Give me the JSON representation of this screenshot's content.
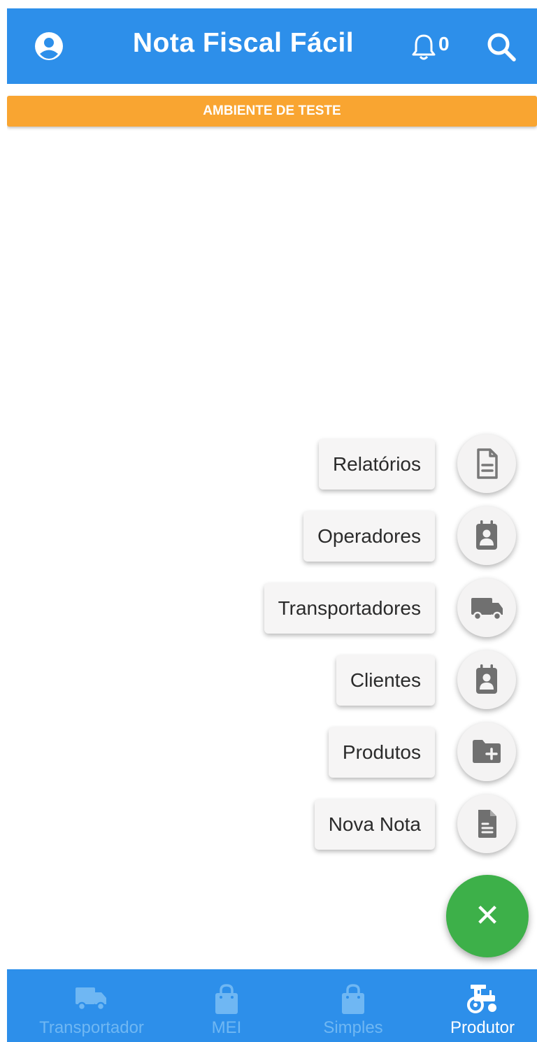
{
  "app": {
    "title": "Nota Fiscal Fácil",
    "notification_count": "0",
    "accent_color": "#2d8fea"
  },
  "banner": {
    "text": "AMBIENTE DE TESTE",
    "color": "#f9a531"
  },
  "menu": {
    "items": [
      {
        "label": "Relatórios",
        "icon": "document-outline-icon"
      },
      {
        "label": "Operadores",
        "icon": "contact-card-icon"
      },
      {
        "label": "Transportadores",
        "icon": "truck-icon"
      },
      {
        "label": "Clientes",
        "icon": "contact-card-icon"
      },
      {
        "label": "Produtos",
        "icon": "folder-add-icon"
      },
      {
        "label": "Nova Nota",
        "icon": "document-filled-icon"
      }
    ]
  },
  "fab": {
    "symbol": "✕",
    "color": "#3db049"
  },
  "bottom_nav": {
    "items": [
      {
        "label": "Transportador",
        "icon": "truck-icon",
        "active": false
      },
      {
        "label": "MEI",
        "icon": "shopping-bag-icon",
        "active": false
      },
      {
        "label": "Simples",
        "icon": "shopping-bag-icon",
        "active": false
      },
      {
        "label": "Produtor",
        "icon": "tractor-icon",
        "active": true
      }
    ]
  }
}
